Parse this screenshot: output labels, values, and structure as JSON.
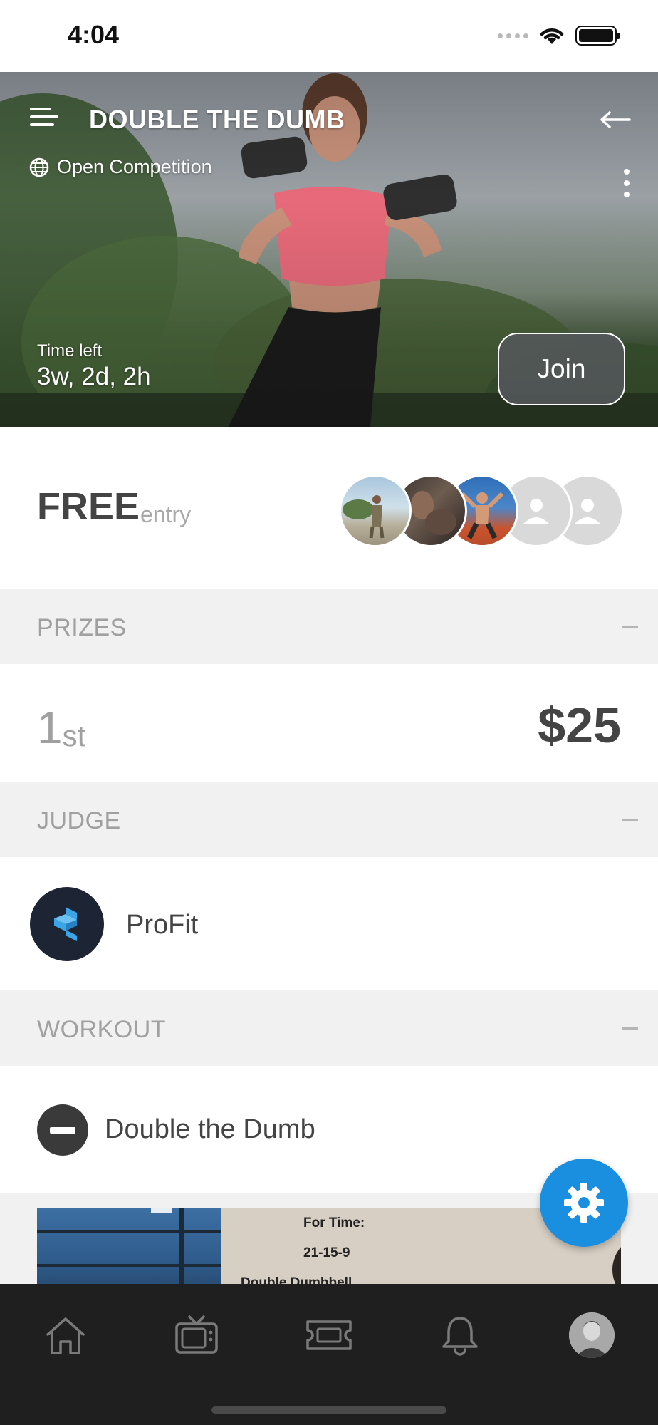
{
  "status_bar": {
    "time": "4:04"
  },
  "hero": {
    "title": "DOUBLE THE DUMB",
    "competition_type": "Open Competition",
    "time_left_label": "Time left",
    "time_left_value": "3w, 2d, 2h",
    "join_label": "Join"
  },
  "entry": {
    "price": "FREE",
    "price_suffix": "entry"
  },
  "sections": {
    "prizes": "PRIZES",
    "judge": "JUDGE",
    "workout": "WORKOUT"
  },
  "prizes": [
    {
      "place_number": "1",
      "place_suffix": "st",
      "amount": "$25"
    }
  ],
  "judge": {
    "name": "ProFit"
  },
  "workout": {
    "name": "Double the Dumb",
    "media_lines": [
      "For Time:",
      "21-15-9",
      "Double Dumbbell"
    ]
  },
  "tab_bar": {
    "items": [
      "home-icon",
      "tv-icon",
      "ticket-icon",
      "bell-icon",
      "profile-avatar"
    ]
  },
  "colors": {
    "accent": "#1a8fe0",
    "tab_bar_bg": "#1f1f1f",
    "section_bg": "#f1f1f1"
  }
}
